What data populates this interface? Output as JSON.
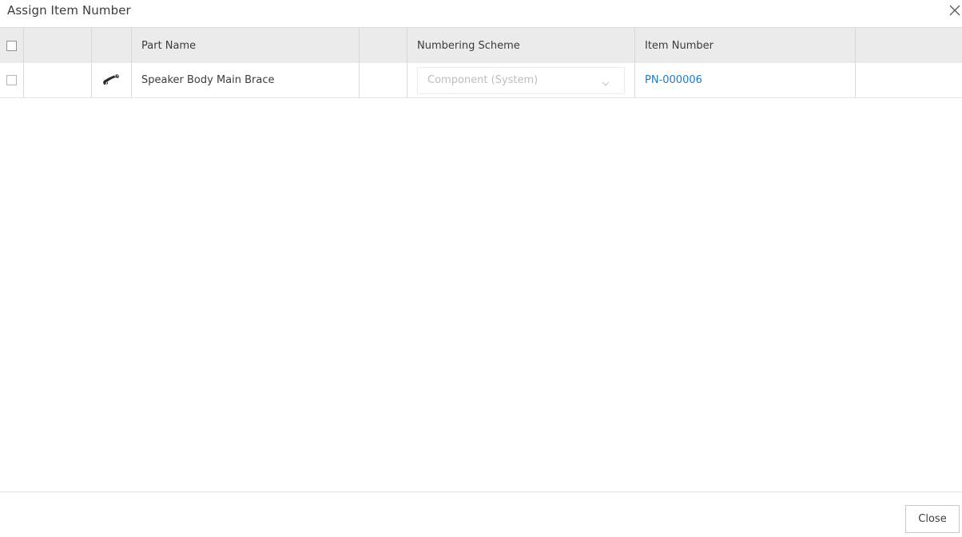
{
  "dialog": {
    "title": "Assign Item Number",
    "close_icon": "close-icon"
  },
  "table": {
    "columns": [
      "",
      "",
      "",
      "Part Name",
      "",
      "Numbering Scheme",
      "Item Number",
      ""
    ],
    "rows": [
      {
        "icon": "part-brace-icon",
        "part_name": "Speaker Body Main Brace",
        "numbering_scheme": "Component (System)",
        "item_number": "PN-000006"
      }
    ]
  },
  "footer": {
    "close_label": "Close"
  },
  "colors": {
    "header_bg": "#ebebeb",
    "link": "#1f7bbf",
    "disabled_text": "#bdbdbd"
  }
}
